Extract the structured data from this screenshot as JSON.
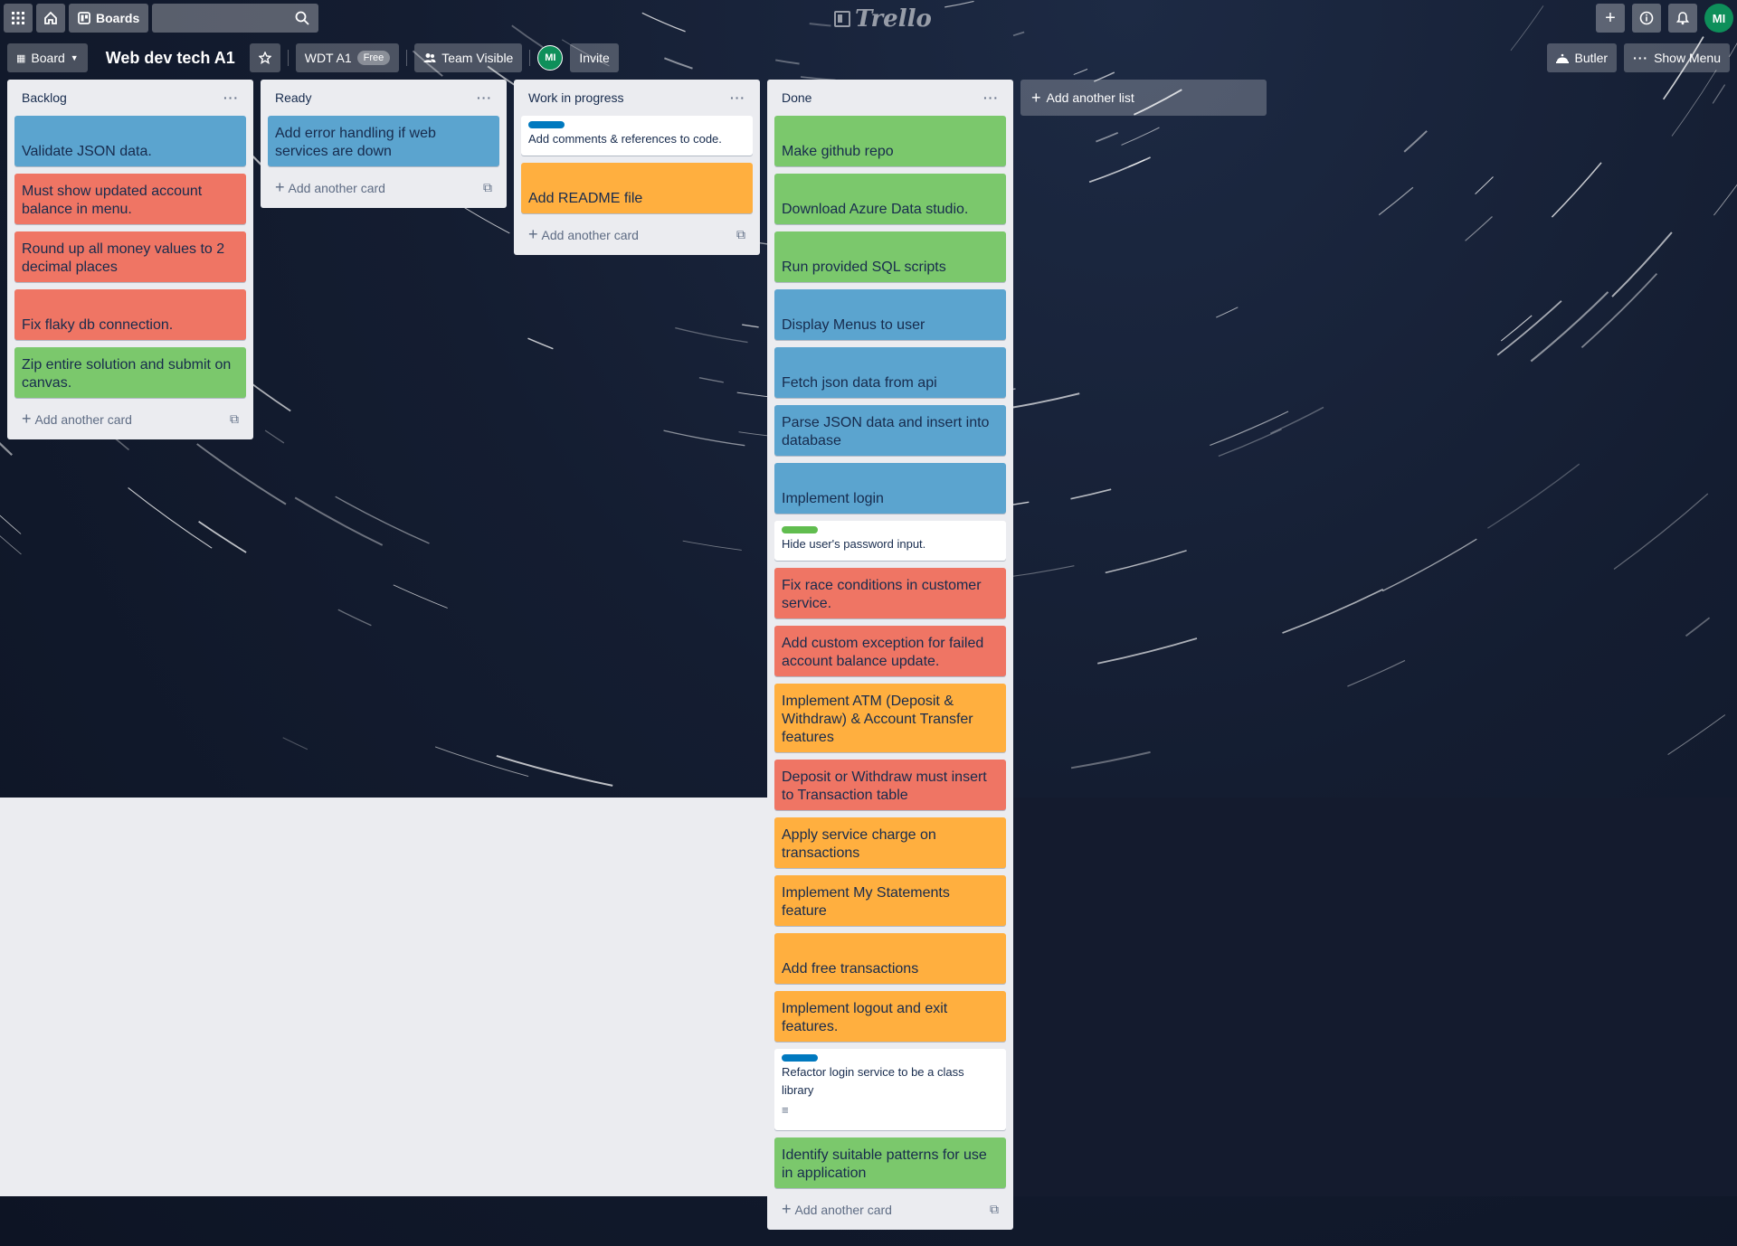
{
  "topnav": {
    "boards_label": "Boards",
    "logo_text": "Trello",
    "user_initials": "MI"
  },
  "header": {
    "board_menu_label": "Board",
    "board_title": "Web dev tech A1",
    "workspace_label": "WDT A1",
    "workspace_badge": "Free",
    "visibility_label": "Team Visible",
    "member_initials": "MI",
    "invite_label": "Invite",
    "butler_label": "Butler",
    "show_menu_label": "Show Menu"
  },
  "lists": [
    {
      "title": "Backlog",
      "add_card_label": "Add another card",
      "cards": [
        {
          "text": "Validate JSON data.",
          "color": "blue"
        },
        {
          "text": "Must show updated account balance in menu.",
          "color": "red"
        },
        {
          "text": "Round up all money values to 2 decimal places",
          "color": "red"
        },
        {
          "text": "Fix flaky db connection.",
          "color": "red"
        },
        {
          "text": "Zip entire solution and submit on canvas.",
          "color": "green"
        }
      ]
    },
    {
      "title": "Ready",
      "add_card_label": "Add another card",
      "cards": [
        {
          "text": "Add error handling if web services are down",
          "color": "blue"
        }
      ]
    },
    {
      "title": "Work in progress",
      "add_card_label": "Add another card",
      "cards": [
        {
          "text": "Add comments & references to code.",
          "color": "white",
          "label_color": "#0079bf"
        },
        {
          "text": "Add README file",
          "color": "orange"
        }
      ]
    },
    {
      "title": "Done",
      "add_card_label": "Add another card",
      "cards": [
        {
          "text": "Make github repo",
          "color": "green"
        },
        {
          "text": "Download Azure Data studio.",
          "color": "green"
        },
        {
          "text": "Run provided SQL scripts",
          "color": "green"
        },
        {
          "text": "Display Menus to user",
          "color": "blue"
        },
        {
          "text": "Fetch json data from api",
          "color": "blue"
        },
        {
          "text": "Parse JSON data and insert into database",
          "color": "blue"
        },
        {
          "text": "Implement login",
          "color": "blue"
        },
        {
          "text": "Hide user's password input.",
          "color": "white",
          "label_color": "#61bd4f"
        },
        {
          "text": "Fix race conditions in customer service.",
          "color": "red"
        },
        {
          "text": "Add custom exception for failed account balance update.",
          "color": "red"
        },
        {
          "text": "Implement ATM (Deposit & Withdraw) & Account Transfer features",
          "color": "orange"
        },
        {
          "text": "Deposit or Withdraw must insert to Transaction table",
          "color": "red"
        },
        {
          "text": "Apply service charge on transactions",
          "color": "orange"
        },
        {
          "text": "Implement My Statements feature",
          "color": "orange"
        },
        {
          "text": "Add free transactions",
          "color": "orange"
        },
        {
          "text": "Implement logout and exit features.",
          "color": "orange"
        },
        {
          "text": "Refactor login service to be a class library",
          "color": "white",
          "label_color": "#0079bf",
          "has_description": true
        },
        {
          "text": "Identify suitable patterns for use in application",
          "color": "green"
        }
      ]
    }
  ],
  "add_list_label": "Add another list",
  "colors": {
    "blue": "#5ba4cf",
    "red": "#ef7564",
    "green": "#7bc86c",
    "orange": "#ffaf3f",
    "label_blue": "#0079bf",
    "label_green": "#61bd4f"
  }
}
